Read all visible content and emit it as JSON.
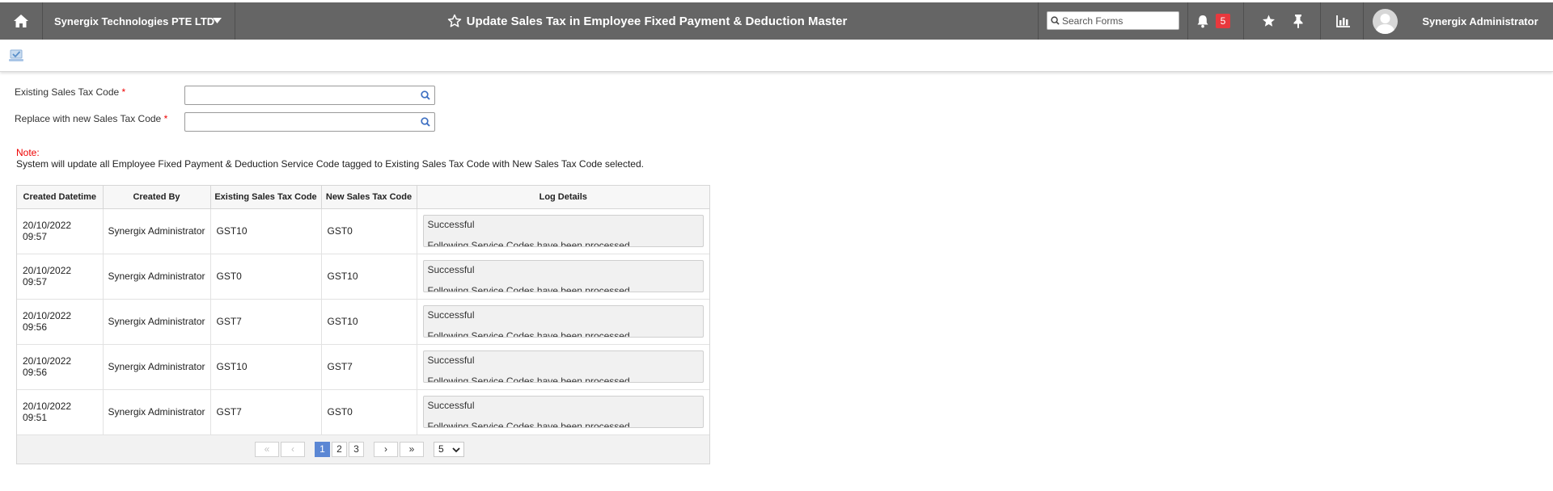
{
  "header": {
    "company": "Synergix Technologies PTE LTD",
    "title": "Update Sales Tax in Employee Fixed Payment & Deduction Master",
    "search_placeholder": "Search Forms",
    "notification_count": "5",
    "user": "Synergix Administrator"
  },
  "form": {
    "existing_label": "Existing Sales Tax Code",
    "replace_label": "Replace with new Sales Tax Code",
    "required_mark": "*",
    "existing_value": "",
    "replace_value": ""
  },
  "note": {
    "label": "Note:",
    "text": "System will update all Employee Fixed Payment & Deduction Service Code tagged to Existing Sales Tax Code with New Sales Tax Code selected."
  },
  "table": {
    "columns": [
      "Created Datetime",
      "Created By",
      "Existing Sales Tax Code",
      "New Sales Tax Code",
      "Log Details"
    ],
    "rows": [
      {
        "datetime": "20/10/2022 09:57",
        "by": "Synergix Administrator",
        "existing": "GST10",
        "new": "GST0",
        "log1": "Successful",
        "log2": "Following Service Codes have been processed"
      },
      {
        "datetime": "20/10/2022 09:57",
        "by": "Synergix Administrator",
        "existing": "GST0",
        "new": "GST10",
        "log1": "Successful",
        "log2": "Following Service Codes have been processed"
      },
      {
        "datetime": "20/10/2022 09:56",
        "by": "Synergix Administrator",
        "existing": "GST7",
        "new": "GST10",
        "log1": "Successful",
        "log2": "Following Service Codes have been processed"
      },
      {
        "datetime": "20/10/2022 09:56",
        "by": "Synergix Administrator",
        "existing": "GST10",
        "new": "GST7",
        "log1": "Successful",
        "log2": "Following Service Codes have been processed"
      },
      {
        "datetime": "20/10/2022 09:51",
        "by": "Synergix Administrator",
        "existing": "GST7",
        "new": "GST0",
        "log1": "Successful",
        "log2": "Following Service Codes have been processed"
      }
    ]
  },
  "pager": {
    "first": "«",
    "prev": "‹",
    "pages": [
      "1",
      "2",
      "3"
    ],
    "next": "›",
    "last": "»",
    "page_size": "5"
  },
  "colors": {
    "header_bg": "#656565",
    "badge": "#e8383d",
    "active_page": "#5b87d4",
    "required": "#ee0000"
  },
  "icons": {
    "home": "home-icon",
    "caret": "caret-down-icon",
    "title_star": "star-outline-icon",
    "search": "search-icon",
    "bell": "bell-icon",
    "favorite": "star-icon",
    "pin": "pin-icon",
    "report": "bar-chart-icon",
    "save": "save-check-icon"
  }
}
